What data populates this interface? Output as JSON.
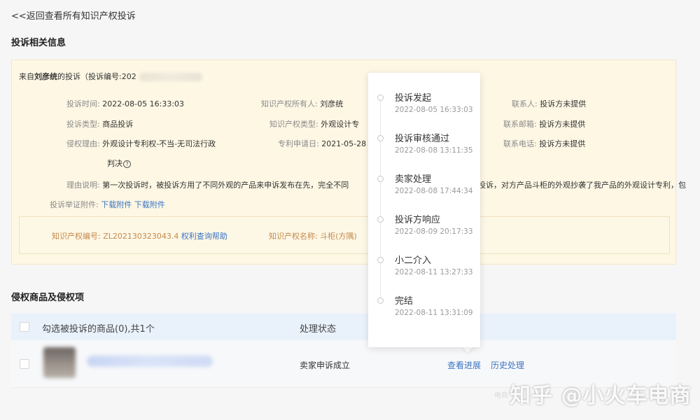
{
  "back_link": "<<返回查看所有知识产权投诉",
  "section_info_title": "投诉相关信息",
  "from": {
    "prefix": "来自",
    "name": "刘彦统",
    "suffix": "的投诉（投诉编号:202"
  },
  "fields": {
    "complaint_time": {
      "label": "投诉时间:",
      "value": "2022-08-05 16:33:03"
    },
    "complaint_type": {
      "label": "投诉类型:",
      "value": "商品投诉"
    },
    "reason": {
      "label": "侵权理由:",
      "value": "外观设计专利权-不当-无司法行政",
      "value2": "判决"
    },
    "owner": {
      "label": "知识产权所有人:",
      "value": "刘彦统"
    },
    "ip_type": {
      "label": "知识产权类型:",
      "value": "外观设计专"
    },
    "patent_date": {
      "label": "专利申请日:",
      "value": "2021-05-28"
    },
    "contact": {
      "label": "联系人:",
      "value": "投诉方未提供"
    },
    "contact_email": {
      "label": "联系邮箱:",
      "value": "投诉方未提供"
    },
    "contact_phone": {
      "label": "联系电话:",
      "value": "投诉方未提供"
    },
    "explanation": {
      "label": "理由说明:",
      "value": "第一次投诉时，被投诉方用了不同外观的产品来申诉发布在先，完全不同",
      "value_tail": "投诉，对方产品斗柜的外观抄袭了我产品的外观设计专利，包"
    },
    "evidence": {
      "label": "投诉举证附件:",
      "link1": "下载附件",
      "link2": "下载附件"
    }
  },
  "ip_box": {
    "number_label": "知识产权编号:",
    "number_value": "ZL202130323043.4",
    "help_link": "权利查询帮助",
    "name_label": "知识产权名称:",
    "name_value": "斗柜(方隅)"
  },
  "section_goods_title": "侵权商品及侵权项",
  "table": {
    "head_select": "勾选被投诉的商品(0),共1个",
    "head_status": "处理状态",
    "row_status": "卖家申诉成立",
    "action_progress": "查看进展",
    "action_history": "历史处理"
  },
  "timeline": [
    {
      "title": "投诉发起",
      "time": "2022-08-05 16:33:03"
    },
    {
      "title": "投诉审核通过",
      "time": "2022-08-08 13:11:35"
    },
    {
      "title": "卖家处理",
      "time": "2022-08-08 17:44:34"
    },
    {
      "title": "投诉方响应",
      "time": "2022-08-09 20:17:33"
    },
    {
      "title": "小二介入",
      "time": "2022-08-11 13:27:33"
    },
    {
      "title": "完结",
      "time": "2022-08-11 13:31:09"
    }
  ],
  "watermark": "知乎 @小火车电商",
  "watermark_small": "电商"
}
